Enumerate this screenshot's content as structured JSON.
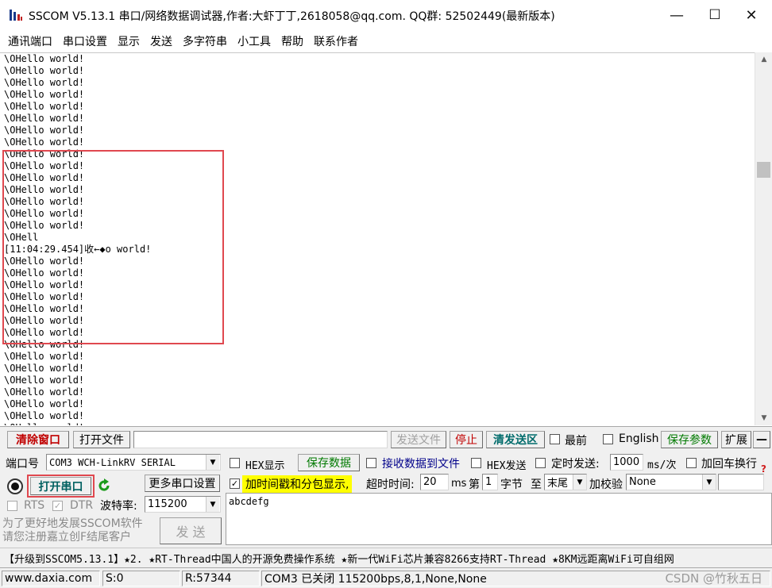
{
  "window": {
    "title": "SSCOM V5.13.1 串口/网络数据调试器,作者:大虾丁丁,2618058@qq.com. QQ群:  52502449(最新版本)",
    "minimize": "—",
    "maximize": "☐",
    "close": "✕"
  },
  "menu": [
    "通讯端口",
    "串口设置",
    "显示",
    "发送",
    "多字符串",
    "小工具",
    "帮助",
    "联系作者"
  ],
  "receive": {
    "lines": [
      "\\OHello world!",
      "\\OHello world!",
      "\\OHello world!",
      "\\OHello world!",
      "\\OHello world!",
      "\\OHello world!",
      "\\OHello world!",
      "\\OHello world!",
      "\\OHello world!",
      "\\OHello world!",
      "\\OHello world!",
      "\\OHello world!",
      "\\OHello world!",
      "\\OHello world!",
      "\\OHello world!",
      "\\OHell",
      "[11:04:29.454]收←◆o world!",
      "\\OHello world!",
      "\\OHello world!",
      "\\OHello world!",
      "\\OHello world!",
      "\\OHello world!",
      "\\OHello world!",
      "\\OHello world!",
      "\\OHello world!",
      "\\OHello world!",
      "\\OHello world!",
      "\\OHello world!",
      "\\OHello world!",
      "\\OHello world!",
      "\\OHello world!",
      "\\OHello world!"
    ]
  },
  "toolbar": {
    "clear_window": "清除窗口",
    "open_file": "打开文件",
    "file_path": "",
    "send_file": "发送文件",
    "stop": "停止",
    "clear_send": "清发送区",
    "topmost": "最前",
    "english": "English",
    "save_params": "保存参数",
    "expand": "扩展",
    "collapse": "—"
  },
  "port": {
    "label": "端口号",
    "value": "COM3 WCH-LinkRV SERIAL",
    "open_button": "打开串口",
    "more_settings": "更多串口设置",
    "rts": "RTS",
    "dtr": "DTR",
    "baud_label": "波特率:",
    "baud_value": "115200",
    "notice": "为了更好地发展SSCOM软件\n请您注册嘉立创F结尾客户",
    "send_button": "发 送"
  },
  "options": {
    "hex_display": "HEX显示",
    "save_data": "保存数据",
    "recv_to_file": "接收数据到文件",
    "hex_send": "HEX发送",
    "timed_send": "定时发送:",
    "timed_value": "1000",
    "timed_unit": "ms/次",
    "add_crlf": "加回车换行",
    "timestamp": "加时间戳和分包显示,",
    "timeout_label": "超时时间:",
    "timeout_value": "20",
    "timeout_unit": "ms",
    "byte_prefix": "第",
    "byte_value": "1",
    "byte_label": "字节",
    "to_label": "至",
    "end_value": "末尾",
    "checksum_label": "加校验",
    "checksum_value": "None"
  },
  "send": {
    "text": "abcdefg"
  },
  "promo": "【升级到SSCOM5.13.1】★2. ★RT-Thread中国人的开源免费操作系统 ★新一代WiFi芯片兼容8266支持RT-Thread ★8KM远距离WiFi可自组网",
  "status": {
    "site": "www.daxia.com",
    "sent": "S:0",
    "received": "R:57344",
    "port_state": "COM3 已关闭  115200bps,8,1,None,None"
  },
  "watermark": "CSDN @竹秋五日",
  "colors": {
    "highlight": "#e0484f",
    "timestamp_bg": "#ffff00",
    "save_data": "#007a00",
    "open_port_border": "#e0484f"
  }
}
